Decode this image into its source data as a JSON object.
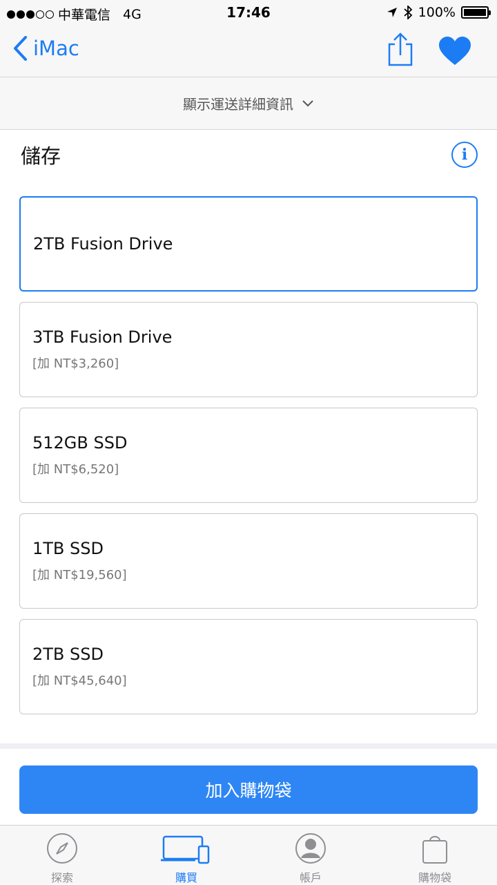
{
  "status_bar": {
    "carrier": "中華電信",
    "network": "4G",
    "time": "17:46",
    "battery": "100%"
  },
  "nav": {
    "back_label": "iMac",
    "share_icon": "share-icon",
    "favorite_icon": "heart-icon"
  },
  "shipping_toggle": "顯示運送詳細資訊",
  "section": {
    "title": "儲存",
    "info_glyph": "i"
  },
  "options": [
    {
      "name": "2TB Fusion Drive",
      "price": "",
      "selected": true
    },
    {
      "name": "3TB Fusion Drive",
      "price": "[加 NT$3,260]",
      "selected": false
    },
    {
      "name": "512GB SSD",
      "price": "[加 NT$6,520]",
      "selected": false
    },
    {
      "name": "1TB SSD",
      "price": "[加 NT$19,560]",
      "selected": false
    },
    {
      "name": "2TB SSD",
      "price": "[加 NT$45,640]",
      "selected": false
    }
  ],
  "add_to_bag": "加入購物袋",
  "tabs": [
    {
      "label": "探索",
      "icon": "compass-icon",
      "active": false
    },
    {
      "label": "購買",
      "icon": "devices-icon",
      "active": true
    },
    {
      "label": "帳戶",
      "icon": "account-icon",
      "active": false
    },
    {
      "label": "購物袋",
      "icon": "bag-icon",
      "active": false
    }
  ],
  "colors": {
    "accent": "#1c7cf4",
    "button": "#2e86f5",
    "inactive_tab": "#8e8e93"
  }
}
